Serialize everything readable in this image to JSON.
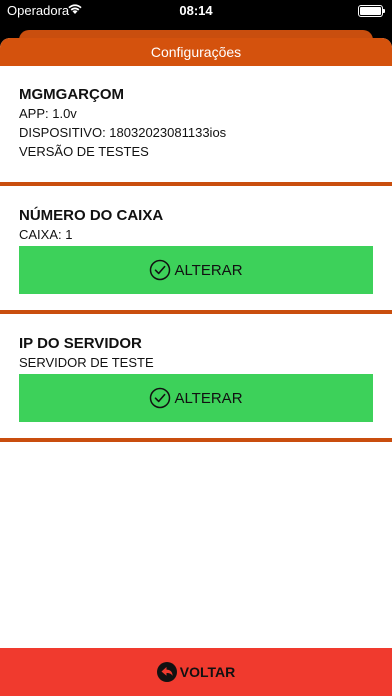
{
  "status_bar": {
    "carrier": "Operadora",
    "time": "08:14"
  },
  "header": {
    "title": "Configurações"
  },
  "app_info": {
    "title": "MGMGARÇOM",
    "app_line": "APP: 1.0v",
    "device_line": "DISPOSITIVO: 18032023081133ios",
    "version_line": "VERSÃO DE TESTES"
  },
  "cashier": {
    "title": "NÚMERO DO CAIXA",
    "value_line": "CAIXA: 1",
    "button_label": "ALTERAR"
  },
  "server": {
    "title": "IP DO SERVIDOR",
    "value_line": "SERVIDOR DE TESTE",
    "button_label": "ALTERAR"
  },
  "footer": {
    "back_label": "VOLTAR"
  },
  "colors": {
    "header": "#d4520d",
    "divider": "#c94e0e",
    "button": "#3dd15a",
    "footer": "#f03a2e"
  },
  "icons": {
    "button": "check-circle-icon",
    "back": "back-arrow-icon",
    "wifi": "wifi-icon",
    "battery": "battery-icon"
  }
}
